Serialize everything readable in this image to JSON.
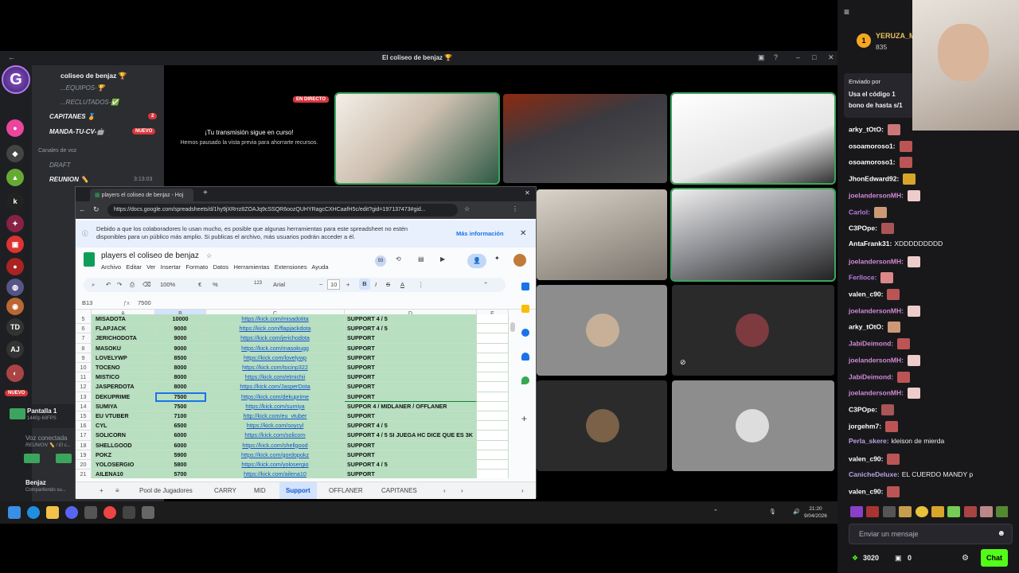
{
  "discord": {
    "window_title": "El coliseo de benjaz 🏆",
    "server_name": "coliseo de benjaz 🏆",
    "channels": [
      {
        "label": "...EQUIPOS-🏆"
      },
      {
        "label": "...RECLUTADOS-✅"
      },
      {
        "label": "CAPITANES 🏅",
        "badge": "2"
      },
      {
        "label": "MANDA-TU-CV-🤖",
        "badge": "NUEVO"
      }
    ],
    "voice_category": "Canales de voz",
    "voice_channels": [
      {
        "label": "DRAFT"
      },
      {
        "label": "REUNION ✏️",
        "time": "3:13:03"
      }
    ],
    "screen_share": {
      "label": "Pantalla 1",
      "sub": "1440p 60FPS"
    },
    "voice_status": {
      "label": "Voz conectada",
      "sub": "REUNION ✏️ / El c..."
    },
    "user": {
      "name": "Benjaz",
      "status": "Compartiendo su..."
    },
    "live_badge": "EN DIRECTO",
    "live_title": "¡Tu transmisión sigue en curso!",
    "live_sub": "Hemos pausado la vista previa para ahorrarte recursos.",
    "server_icons": [
      "TD",
      "AJ"
    ],
    "new_badge": "NUEVO"
  },
  "browser": {
    "tab_title": "players el coliseo de benjaz - Hoj",
    "url": "https://docs.google.com/spreadsheets/d/1hy9jXRrrz8ZOAJq9cSSQR6oozQUHYRagcCXHCaafH5c/edit?gid=197137473#gid..."
  },
  "sheet": {
    "info_text": "Debido a que los colaboradores lo usan mucho, es posible que algunas herramientas para este spreadsheet no estén disponibles para un público más amplio. Si publicas el archivo, más usuarios podrán acceder a él.",
    "info_link": "Más información",
    "title": "players el coliseo de benjaz",
    "menu": [
      "Archivo",
      "Editar",
      "Ver",
      "Insertar",
      "Formato",
      "Datos",
      "Herramientas",
      "Extensiones",
      "Ayuda"
    ],
    "toolbar": {
      "zoom": "100%",
      "font": "Arial",
      "size": "10",
      "currency": "€",
      "percent": "%",
      "decimals": "123"
    },
    "collab_count": "93",
    "cell_ref": "B13",
    "cell_value": "7500",
    "columns": [
      "A",
      "B",
      "C",
      "D",
      "E"
    ],
    "rows": [
      {
        "n": "5",
        "a": "MISADOTA",
        "b": "10000",
        "c": "https://kick.com/misadotita",
        "d": "SUPPORT 4 / 5"
      },
      {
        "n": "6",
        "a": "FLAPJACK",
        "b": "9000",
        "c": "https://kick.com/flapjackdota",
        "d": "SUPPORT 4 / 5"
      },
      {
        "n": "7",
        "a": "JERICHODOTA",
        "b": "9000",
        "c": "https://kick.com/jerichodota",
        "d": "SUPPORT"
      },
      {
        "n": "8",
        "a": "MASOKU",
        "b": "9000",
        "c": "https://kick.com/masokugg",
        "d": "SUPPORT"
      },
      {
        "n": "9",
        "a": "LOVELYWP",
        "b": "8500",
        "c": "https://kick.com/lovelywp",
        "d": "SUPPORT"
      },
      {
        "n": "10",
        "a": "TOCENO",
        "b": "8000",
        "c": "https://kick.com/tocinp322",
        "d": "SUPPORT"
      },
      {
        "n": "11",
        "a": "MISTICO",
        "b": "8000",
        "c": "https://kick.com/elmichii",
        "d": "SUPPORT"
      },
      {
        "n": "12",
        "a": "JASPERDOTA",
        "b": "8000",
        "c": "https://kick.com/JasperDota",
        "d": "SUPPORT"
      },
      {
        "n": "13",
        "a": "DEKUPRIME",
        "b": "7500",
        "c": "https://kick.com/dekuprime",
        "d": "SUPPORT"
      },
      {
        "n": "14",
        "a": "SUMIYA",
        "b": "7500",
        "c": "https://kick.com/sumiya",
        "d": "SUPPOR 4 / MIDLANER / OFFLANER"
      },
      {
        "n": "15",
        "a": "EU VTUBER",
        "b": "7100",
        "c": "http://kick.com/eu_vtuber",
        "d": "SUPPORT"
      },
      {
        "n": "16",
        "a": "CYL",
        "b": "6500",
        "c": "https://kick.com/soycyl",
        "d": "SUPPORT 4 / 5"
      },
      {
        "n": "17",
        "a": "SOLICORN",
        "b": "6000",
        "c": "https://kick.com/solicorn",
        "d": "SUPPORT 4 / 5 SI JUEGA HC DICE QUE ES 3K"
      },
      {
        "n": "18",
        "a": "SHELLGOOD",
        "b": "6000",
        "c": "https://kick.com/shellgood",
        "d": "SUPPORT"
      },
      {
        "n": "19",
        "a": "POKZ",
        "b": "5900",
        "c": "https://kick.com/gordopokz",
        "d": "SUPPORT"
      },
      {
        "n": "20",
        "a": "YOLOSERGIO",
        "b": "5800",
        "c": "https://kick.com/yolosergio",
        "d": "SUPPORT 4 / 5"
      },
      {
        "n": "21",
        "a": "AILENA10",
        "b": "5700",
        "c": "https://kick.com/ailena10",
        "d": "SUPPORT"
      }
    ],
    "tabs": [
      "Pool de Jugadores",
      "CARRY",
      "MID",
      "Support",
      "OFFLANER",
      "CAPITANES"
    ],
    "active_tab": "Support"
  },
  "taskbar": {
    "time": "21:20",
    "date": "9/04/2026"
  },
  "chat": {
    "top_user": "YERUZA_M",
    "top_points": "835",
    "pinned_by": "Enviado por",
    "pinned_text": "Usa el código 1",
    "pinned_text2": "bono de hasta s/1",
    "messages": [
      {
        "user": "arky_tOtO:",
        "color": "#ffffff",
        "text": ""
      },
      {
        "user": "osoamoroso1:",
        "color": "#ffffff",
        "text": ""
      },
      {
        "user": "osoamoroso1:",
        "color": "#ffffff",
        "text": ""
      },
      {
        "user": "JhonEdward92:",
        "color": "#ffffff",
        "text": ""
      },
      {
        "user": "joelandersonMH:",
        "color": "#d38bd6",
        "text": ""
      },
      {
        "user": "Carlol:",
        "color": "#b77de0",
        "text": ""
      },
      {
        "user": "C3POpe:",
        "color": "#ffffff",
        "text": ""
      },
      {
        "user": "AntaFrank31:",
        "color": "#ffffff",
        "text": "XDDDDDDDDD"
      },
      {
        "user": "joelandersonMH:",
        "color": "#d38bd6",
        "text": ""
      },
      {
        "user": "Ferlloce:",
        "color": "#b77de0",
        "text": ""
      },
      {
        "user": "valen_c90:",
        "color": "#ffffff",
        "text": ""
      },
      {
        "user": "joelandersonMH:",
        "color": "#d38bd6",
        "text": ""
      },
      {
        "user": "arky_tOtO:",
        "color": "#ffffff",
        "text": ""
      },
      {
        "user": "JabiDeimond:",
        "color": "#d38bd6",
        "text": ""
      },
      {
        "user": "joelandersonMH:",
        "color": "#d38bd6",
        "text": ""
      },
      {
        "user": "JabiDeimond:",
        "color": "#d38bd6",
        "text": ""
      },
      {
        "user": "joelandersonMH:",
        "color": "#d38bd6",
        "text": ""
      },
      {
        "user": "C3POpe:",
        "color": "#ffffff",
        "text": ""
      },
      {
        "user": "jorgehm7:",
        "color": "#ffffff",
        "text": ""
      },
      {
        "user": "Perla_skere:",
        "color": "#b9a3e3",
        "text": "kleison de mierda"
      },
      {
        "user": "valen_c90:",
        "color": "#ffffff",
        "text": ""
      },
      {
        "user": "CanicheDeluxe:",
        "color": "#b9a3e3",
        "text": "EL CUERDO MANDY p"
      },
      {
        "user": "valen_c90:",
        "color": "#ffffff",
        "text": ""
      }
    ],
    "input_placeholder": "Enviar un mensaje",
    "points": "3020",
    "viewers": "0",
    "chat_button": "Chat"
  }
}
